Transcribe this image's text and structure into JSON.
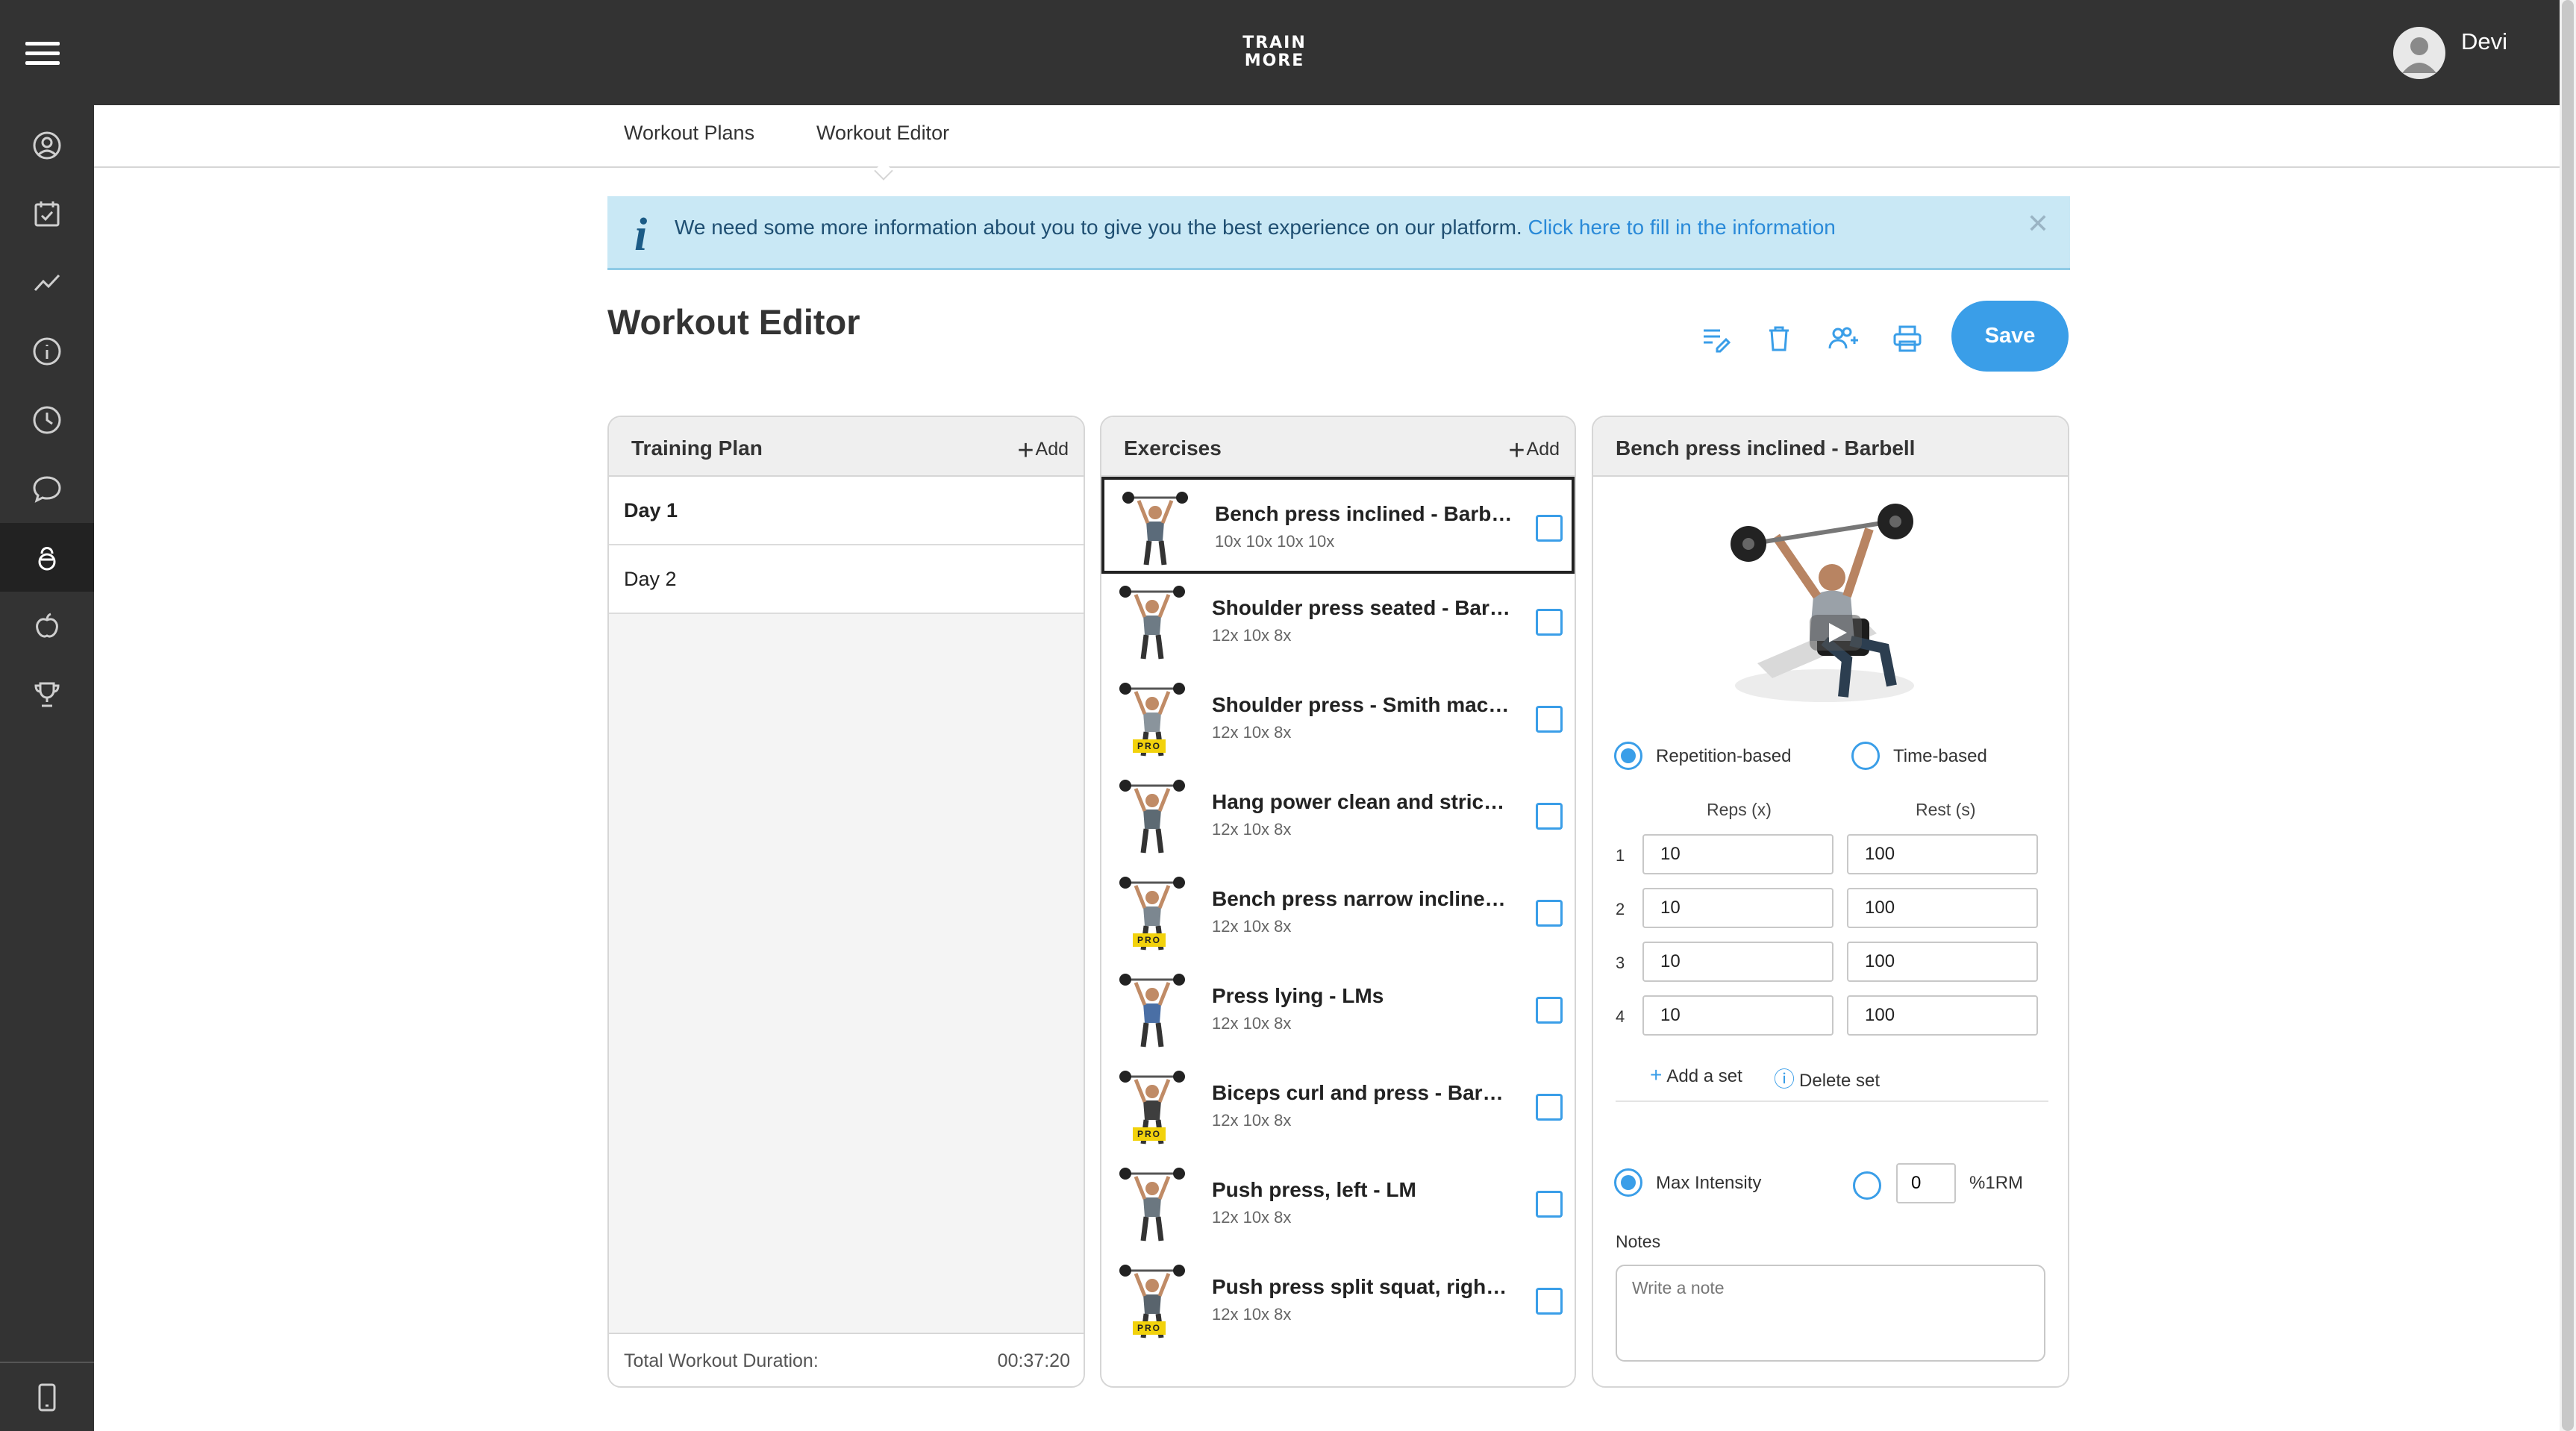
{
  "app": {
    "logo_line1": "TRAIN",
    "logo_line2": "MORE",
    "user_name": "Devi"
  },
  "sidebar": {
    "items": [
      {
        "icon": "user-circle-icon"
      },
      {
        "icon": "calendar-check-icon"
      },
      {
        "icon": "trend-line-icon"
      },
      {
        "icon": "info-circle-icon"
      },
      {
        "icon": "clock-icon"
      },
      {
        "icon": "chat-bubble-icon"
      },
      {
        "icon": "kettlebell-icon",
        "active": true
      },
      {
        "icon": "apple-icon"
      },
      {
        "icon": "trophy-icon"
      },
      {
        "icon": "mobile-phone-icon"
      }
    ]
  },
  "tabs": [
    {
      "label": "Workout Plans"
    },
    {
      "label": "Workout Editor",
      "active": true
    }
  ],
  "banner": {
    "text": "We need some more information about you to give you the best experience on our platform.",
    "link": "Click here to fill in the information",
    "close": "✕"
  },
  "page": {
    "title": "Workout Editor",
    "save_label": "Save"
  },
  "toolbar": {
    "icons": [
      "edit-list-icon",
      "trash-icon",
      "add-users-icon",
      "print-icon"
    ]
  },
  "training_plan": {
    "title": "Training Plan",
    "add_label": "Add",
    "days": [
      {
        "label": "Day 1",
        "bold": true
      },
      {
        "label": "Day 2"
      }
    ],
    "footer_label": "Total Workout Duration:",
    "footer_value": "00:37:20"
  },
  "exercises": {
    "title": "Exercises",
    "add_label": "Add",
    "pro_label": "PRO",
    "items": [
      {
        "name": "Bench press inclined - Barbell",
        "sets": "10x 10x 10x 10x",
        "pro": false,
        "selected": true
      },
      {
        "name": "Shoulder press seated - Barbell",
        "sets": "12x 10x 8x",
        "pro": false
      },
      {
        "name": "Shoulder press - Smith machi...",
        "sets": "12x 10x 8x",
        "pro": true
      },
      {
        "name": "Hang power clean and strict ...",
        "sets": "12x 10x 8x",
        "pro": false
      },
      {
        "name": "Bench press narrow incline - ...",
        "sets": "12x 10x 8x",
        "pro": true
      },
      {
        "name": "Press lying - LMs",
        "sets": "12x 10x 8x",
        "pro": false
      },
      {
        "name": "Biceps curl and press - Barbell",
        "sets": "12x 10x 8x",
        "pro": true
      },
      {
        "name": "Push press, left - LM",
        "sets": "12x 10x 8x",
        "pro": false
      },
      {
        "name": "Push press split squat, right - ...",
        "sets": "12x 10x 8x",
        "pro": true
      }
    ]
  },
  "detail": {
    "title": "Bench press inclined - Barbell",
    "mode_rep": "Repetition-based",
    "mode_time": "Time-based",
    "reps_header": "Reps (x)",
    "rest_header": "Rest (s)",
    "sets": [
      {
        "num": "1",
        "reps": "10",
        "rest": "100"
      },
      {
        "num": "2",
        "reps": "10",
        "rest": "100"
      },
      {
        "num": "3",
        "reps": "10",
        "rest": "100"
      },
      {
        "num": "4",
        "reps": "10",
        "rest": "100"
      }
    ],
    "add_set": "Add a set",
    "delete_set": "Delete set",
    "max_intensity": "Max Intensity",
    "rm_value": "0",
    "rm_label": "%1RM",
    "notes_label": "Notes",
    "notes_placeholder": "Write a note"
  },
  "colors": {
    "topbar": "#333333",
    "accent": "#3a9ee8",
    "banner_bg": "#c9e8f5",
    "pro_badge": "#f2d20c"
  }
}
